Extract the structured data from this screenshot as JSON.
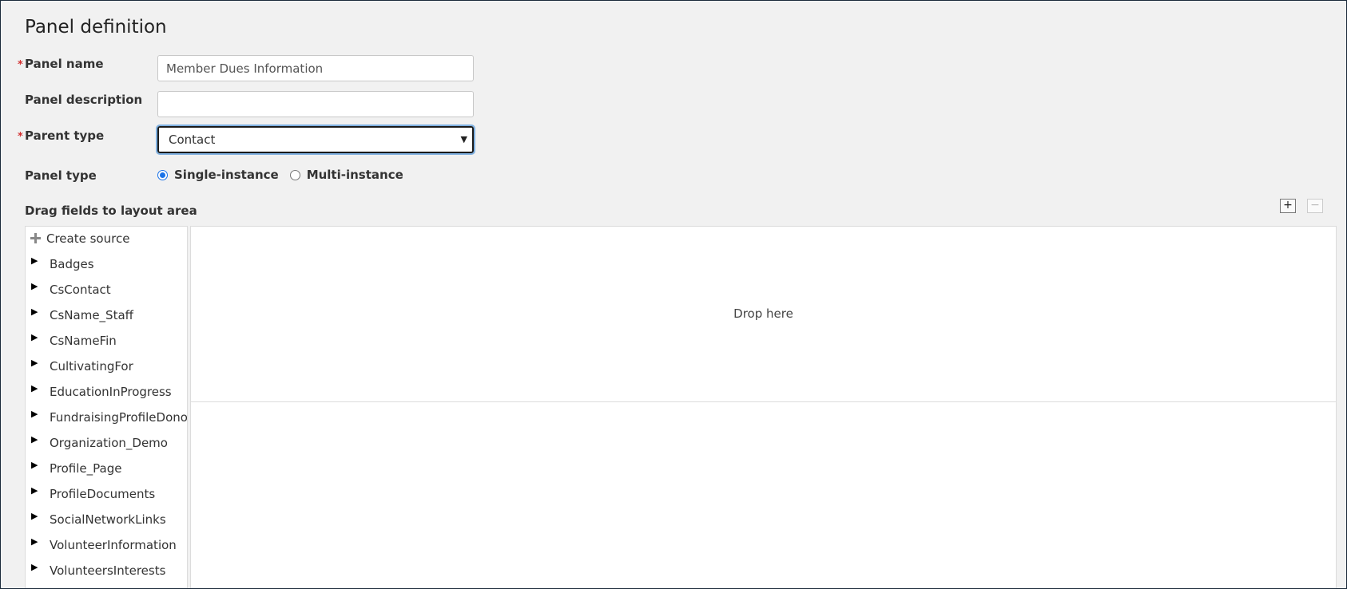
{
  "page": {
    "title": "Panel definition"
  },
  "form": {
    "panel_name": {
      "label": "Panel name",
      "required": "*",
      "value": "Member Dues Information"
    },
    "panel_description": {
      "label": "Panel description",
      "value": ""
    },
    "parent_type": {
      "label": "Parent type",
      "required": "*",
      "selected": "Contact"
    },
    "panel_type": {
      "label": "Panel type",
      "options": [
        "Single-instance",
        "Multi-instance"
      ],
      "selected": "Single-instance"
    }
  },
  "layout": {
    "drag_label": "Drag fields to layout area",
    "add_button": "+",
    "remove_button": "−",
    "drop_text": "Drop here"
  },
  "sources": {
    "create_label": "Create source",
    "items": [
      "Badges",
      "CsContact",
      "CsName_Staff",
      "CsNameFin",
      "CultivatingFor",
      "EducationInProgress",
      "FundraisingProfileDonor",
      "Organization_Demo",
      "Profile_Page",
      "ProfileDocuments",
      "SocialNetworkLinks",
      "VolunteerInformation",
      "VolunteersInterests"
    ]
  },
  "colors": {
    "background": "#f1f1f1",
    "accent": "#1a73e8",
    "required": "#d32f2f"
  }
}
